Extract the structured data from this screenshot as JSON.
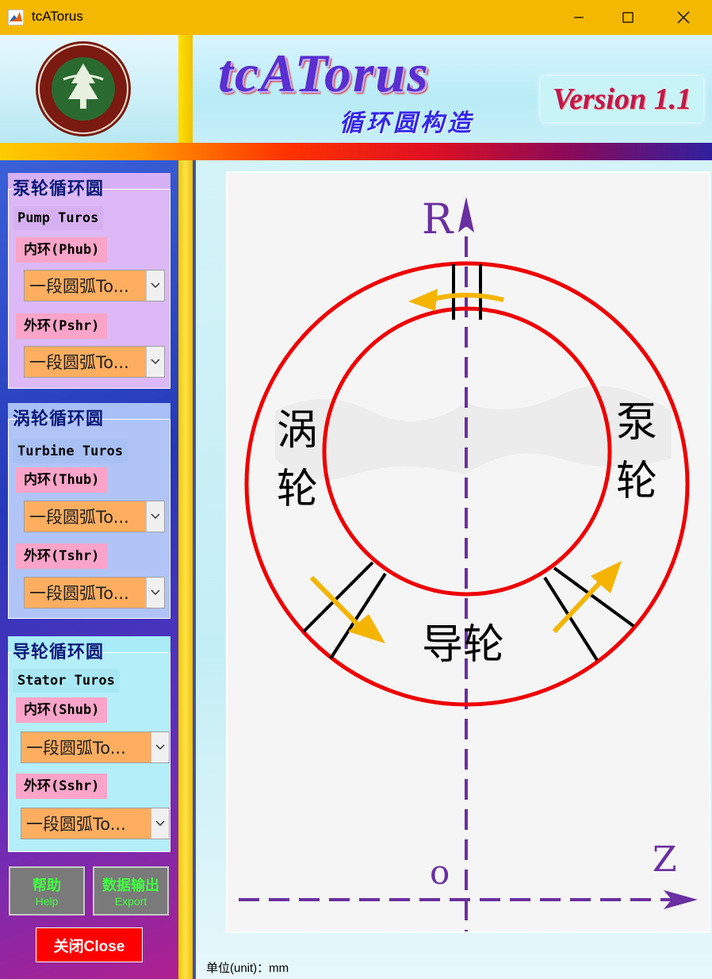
{
  "window": {
    "title": "tcATorus",
    "controls": [
      "minimize",
      "maximize",
      "close"
    ]
  },
  "banner": {
    "app_name": "tcATorus",
    "subtitle": "循环圆构造",
    "version": "Version 1.1",
    "logo_icon": "university-seal-icon"
  },
  "sidebar": {
    "pump": {
      "title": "泵轮循环圆",
      "subtitle": "Pump Turos",
      "inner_label": "内环(Phub)",
      "inner_value": "一段圆弧To...",
      "outer_label": "外环(Pshr)",
      "outer_value": "一段圆弧To..."
    },
    "turbine": {
      "title": "涡轮循环圆",
      "subtitle": "Turbine Turos",
      "inner_label": "内环(Thub)",
      "inner_value": "一段圆弧To...",
      "outer_label": "外环(Tshr)",
      "outer_value": "一段圆弧To..."
    },
    "stator": {
      "title": "导轮循环圆",
      "subtitle": "Stator Turos",
      "inner_label": "内环(Shub)",
      "inner_value": "一段圆弧To...",
      "outer_label": "外环(Sshr)",
      "outer_value": "一段圆弧To..."
    },
    "buttons": {
      "help_cn": "帮助",
      "help_en": "Help",
      "export_cn": "数据输出",
      "export_en": "Export",
      "close": "关闭Close"
    }
  },
  "diagram": {
    "axis_r": "R",
    "axis_z": "Z",
    "origin": "o",
    "turbine_char1": "涡",
    "turbine_char2": "轮",
    "pump_char1": "泵",
    "pump_char2": "轮",
    "stator": "导轮",
    "colors": {
      "torus": "#ee0000",
      "axis": "#6a2fa0",
      "arrow": "#f5b400",
      "blade": "#000000"
    }
  },
  "status": {
    "unit": "单位(unit)：mm"
  }
}
